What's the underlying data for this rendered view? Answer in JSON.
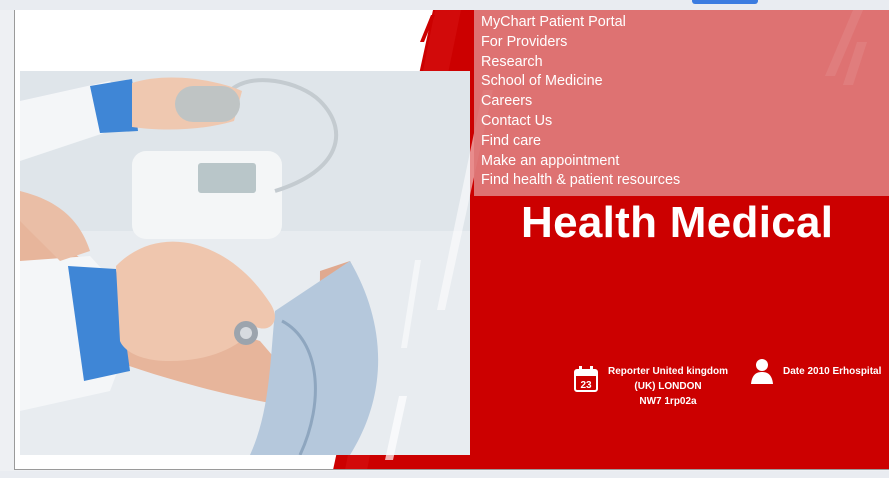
{
  "menu": {
    "items": [
      "MyChart Patient Portal",
      "For Providers",
      "Research",
      "School of Medicine",
      "Careers",
      "Contact Us",
      "Find care",
      "Make an appointment",
      "Find health & patient resources"
    ]
  },
  "hero": {
    "title": "Health Medical"
  },
  "reporter": {
    "line1": "Reporter United kingdom",
    "line2": "(UK) LONDON",
    "line3": "NW7 1rp02a",
    "calendar_day": "23",
    "icon": "calendar-icon"
  },
  "date": {
    "text": "Date 2010 Erhospital",
    "icon": "person-icon"
  },
  "photo": {
    "icon": "medical-photo"
  },
  "colors": {
    "brand_red": "#cc0000",
    "menu_pink": "#de7878",
    "white": "#ffffff"
  }
}
